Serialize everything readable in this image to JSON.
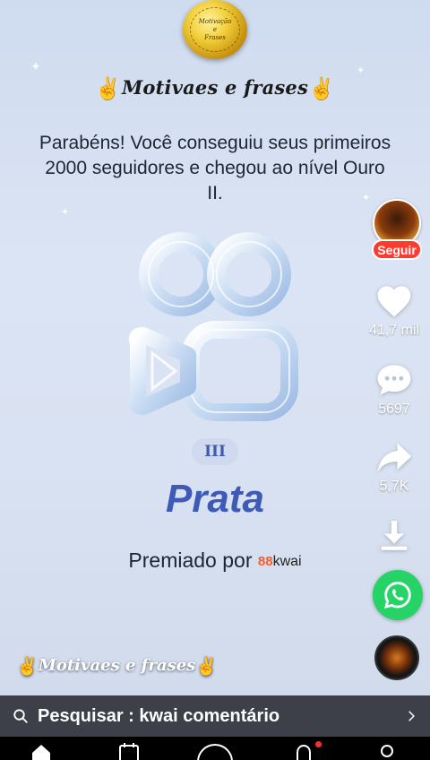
{
  "seal": {
    "line1": "Motivação",
    "line2": "e",
    "line3": "Frases"
  },
  "brand_title": "Motivaes e frases",
  "message": "Parabéns! Você conseguiu seus primeiros 2000 seguidores e chegou ao nível Ouro II.",
  "badge": {
    "roman": "III",
    "rank": "Prata"
  },
  "awarded": {
    "prefix": "Premiado por",
    "brand": "kwai",
    "brand_icon": "88"
  },
  "rail": {
    "follow_label": "Seguir",
    "likes": "41,7 mil",
    "comments": "5697",
    "shares": "5,7K"
  },
  "caption": "Motivaes e frases",
  "search": {
    "label": "Pesquisar : kwai comentário"
  },
  "colors": {
    "follow": "#ff3b30",
    "whatsapp": "#25d366",
    "rank": "#3d5ab6"
  }
}
